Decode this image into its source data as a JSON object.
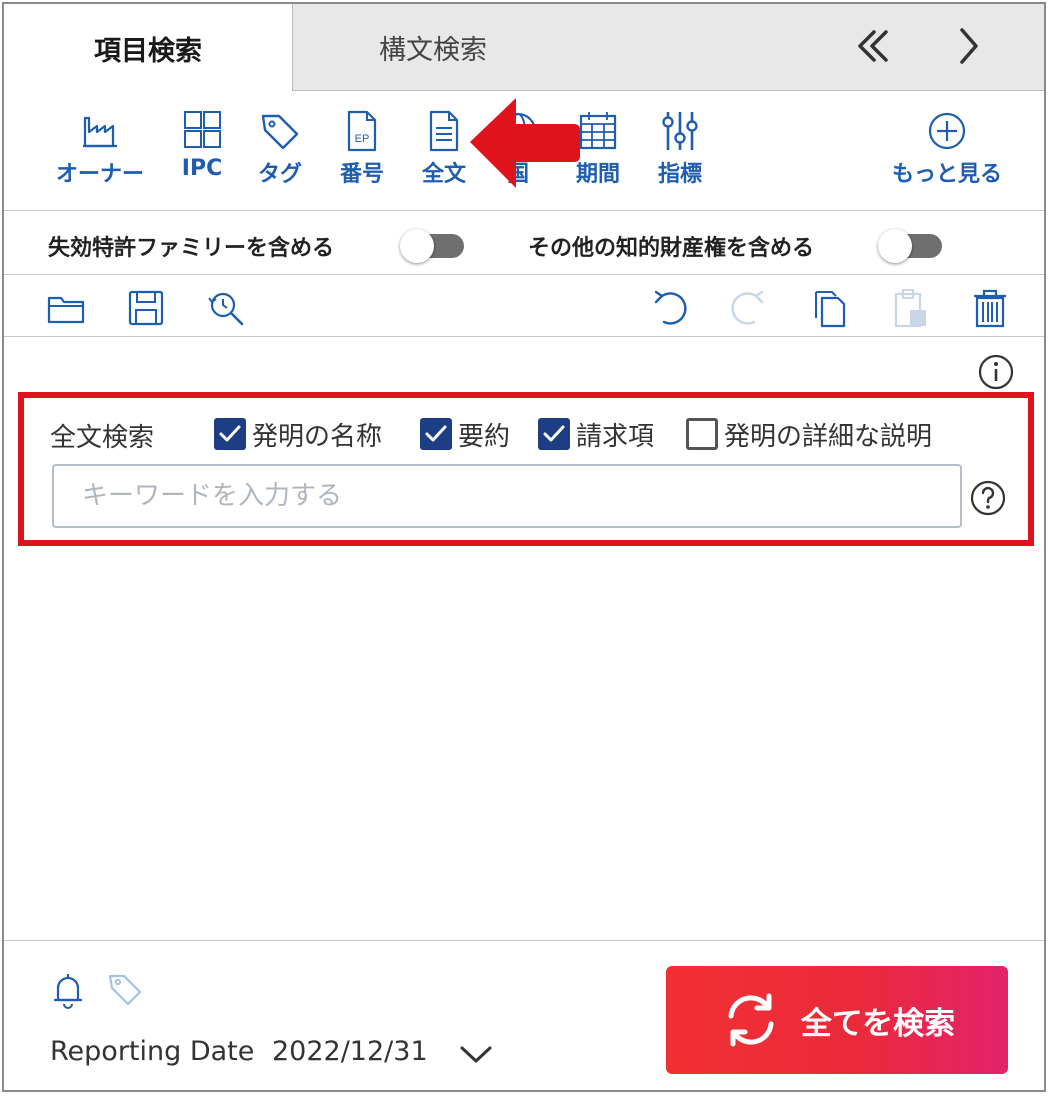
{
  "tabs": [
    {
      "label": "項目検索",
      "active": true
    },
    {
      "label": "構文検索",
      "active": false
    }
  ],
  "nav": {
    "collapse_icon": "double-chevron-left-icon",
    "next_icon": "chevron-right-icon"
  },
  "toolbar": [
    {
      "label": "オーナー",
      "icon": "factory-icon"
    },
    {
      "label": "IPC",
      "icon": "grid-icon"
    },
    {
      "label": "タグ",
      "icon": "tag-icon"
    },
    {
      "label": "番号",
      "icon": "ep-document-icon"
    },
    {
      "label": "全文",
      "icon": "document-icon"
    },
    {
      "label": "国",
      "icon": "globe-icon"
    },
    {
      "label": "期間",
      "icon": "calendar-icon"
    },
    {
      "label": "指標",
      "icon": "sliders-icon"
    },
    {
      "label": "もっと見る",
      "icon": "plus-circle-icon"
    }
  ],
  "toggles": {
    "family": {
      "label": "失効特許ファミリーを含める",
      "on": false
    },
    "other_ip": {
      "label": "その他の知的財産権を含める",
      "on": false
    }
  },
  "actions": [
    "folder-icon",
    "save-icon",
    "history-search-icon",
    "undo-icon",
    "redo-icon",
    "copy-icon",
    "paste-icon",
    "trash-icon"
  ],
  "fulltext": {
    "label": "全文検索",
    "options": [
      {
        "label": "発明の名称",
        "checked": true
      },
      {
        "label": "要約",
        "checked": true
      },
      {
        "label": "請求項",
        "checked": true
      },
      {
        "label": "発明の詳細な説明",
        "checked": false
      }
    ],
    "placeholder": "キーワードを入力する",
    "value": ""
  },
  "footer": {
    "reporting_date_label": "Reporting Date",
    "reporting_date_value": "2022/12/31",
    "search_all_label": "全てを検索"
  },
  "colors": {
    "accent_blue": "#1e5db0",
    "checkbox_blue": "#1d3e84",
    "highlight_red": "#e0131d",
    "button_red": "#f23033"
  }
}
